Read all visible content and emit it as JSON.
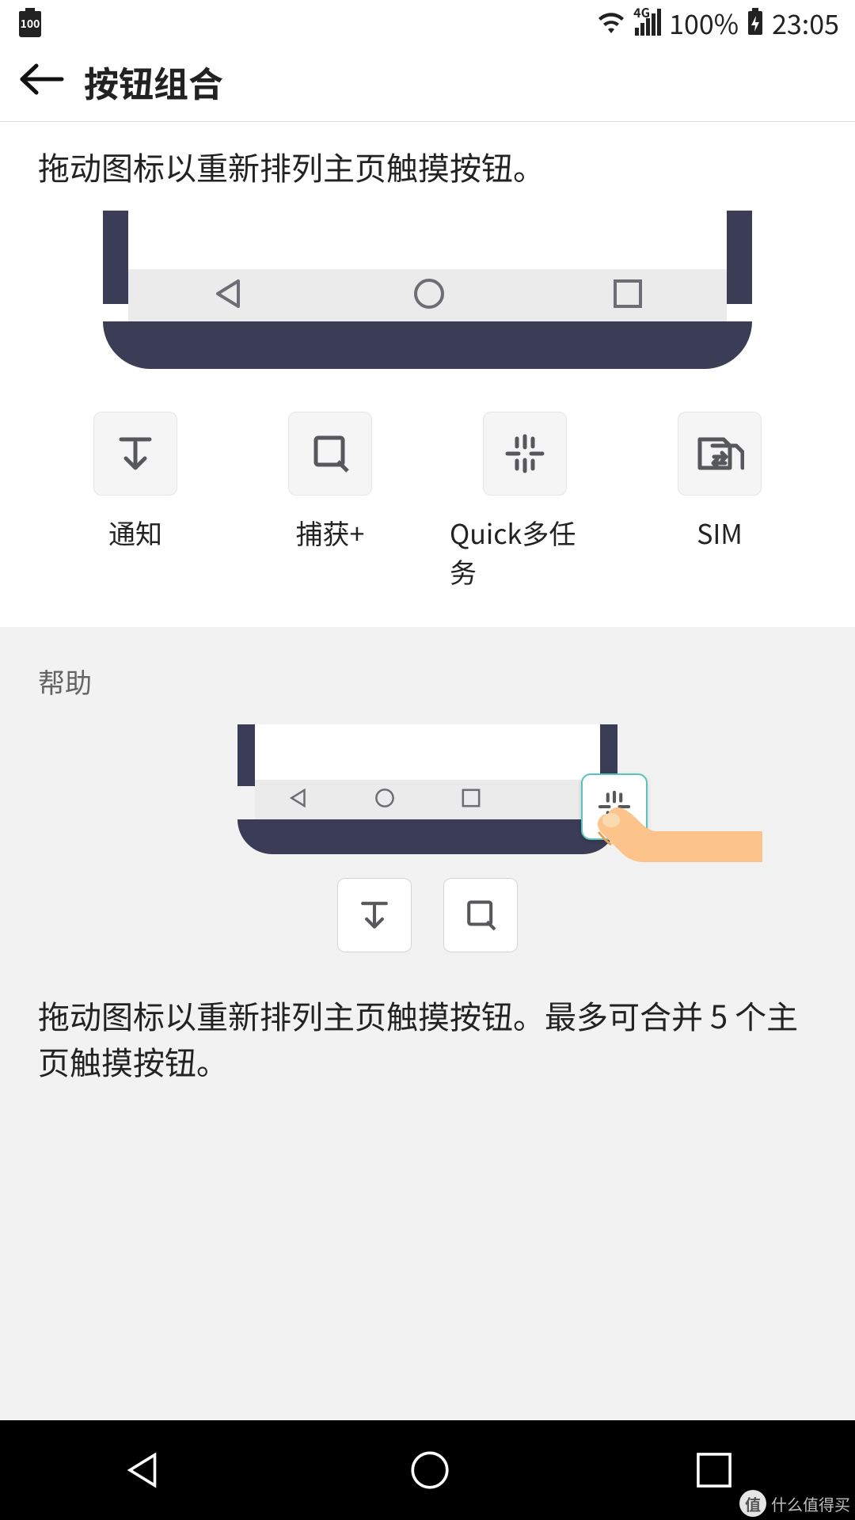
{
  "statusbar": {
    "battery_value": "100",
    "signal_label": "4G",
    "battery_text": "100%",
    "clock": "23:05"
  },
  "header": {
    "title": "按钮组合"
  },
  "main": {
    "instruction": "拖动图标以重新排列主页触摸按钮。",
    "nav_buttons": [
      {
        "name": "back",
        "icon": "triangle-left"
      },
      {
        "name": "home",
        "icon": "circle"
      },
      {
        "name": "recent",
        "icon": "square"
      }
    ],
    "tray_items": [
      {
        "label": "通知",
        "icon": "notification-pull",
        "name": "tray-notification"
      },
      {
        "label": "捕获+",
        "icon": "capture-plus",
        "name": "tray-capture-plus"
      },
      {
        "label": "Quick多任务",
        "icon": "quick-memo",
        "name": "tray-quick-multitask"
      },
      {
        "label": "SIM",
        "icon": "sim-switch",
        "name": "tray-sim"
      }
    ]
  },
  "help": {
    "title": "帮助",
    "dragging_icon": "quick-memo",
    "below_tiles": [
      "notification-pull",
      "capture-plus"
    ],
    "text": "拖动图标以重新排列主页触摸按钮。最多可合并 5 个主页触摸按钮。"
  },
  "watermark": {
    "badge": "值",
    "text": "什么值得买"
  }
}
